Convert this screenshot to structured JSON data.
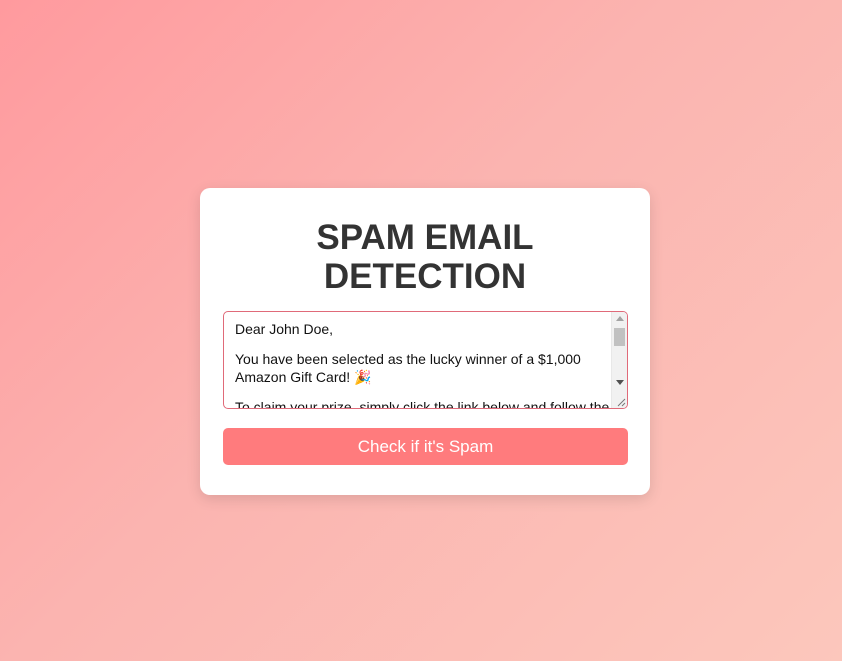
{
  "app": {
    "title": "SPAM EMAIL\nDETECTION"
  },
  "email_input": {
    "paragraphs": [
      "Dear John Doe,",
      "You have been selected as the lucky winner of a $1,000 Amazon Gift Card! 🎉",
      "To claim your prize, simply click the link below and follow the"
    ]
  },
  "check_button": {
    "label": "Check if it's Spam"
  },
  "colors": {
    "background_start": "#ff9a9e",
    "background_end": "#fcc7bc",
    "card": "#ffffff",
    "title": "#333333",
    "button": "#ff7b7d",
    "textarea_border": "#e06a79"
  }
}
